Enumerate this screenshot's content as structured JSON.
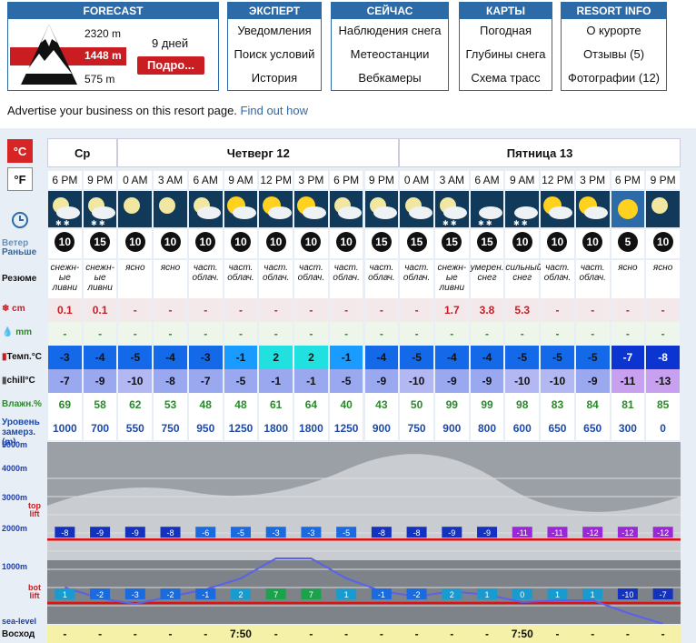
{
  "nav": {
    "forecast": {
      "title": "FORECAST",
      "elev_top": "2320 m",
      "elev_mid": "1448 m",
      "elev_bot": "575 m",
      "days": "9 дней",
      "detail": "Подро..."
    },
    "expert": {
      "title": "ЭКСПЕРТ",
      "items": [
        "Уведомления",
        "Поиск условий",
        "История"
      ]
    },
    "now": {
      "title": "СЕЙЧАС",
      "items": [
        "Наблюдения снега",
        "Метеостанции",
        "Вебкамеры"
      ]
    },
    "maps": {
      "title": "КАРТЫ",
      "items": [
        "Погодная",
        "Глубины снега",
        "Схема трасс"
      ]
    },
    "resort": {
      "title": "RESORT INFO",
      "items": [
        "О курорте",
        "Отзывы (5)",
        "Фотографии (12)"
      ]
    }
  },
  "advert": {
    "text": "Advertise your business on this resort page.",
    "link": "Find out how"
  },
  "units": {
    "c": "°C",
    "f": "°F"
  },
  "labels": {
    "earlier": "Раньше",
    "wind": "Ветер",
    "summary": "Резюме",
    "snow": "cm",
    "rain": "mm",
    "temp": "Темп.°C",
    "chill": "chill°C",
    "humidity": "Влажн.%",
    "freeze_level": "Уровень замерз. (m)",
    "sunrise": "Восход"
  },
  "days": [
    {
      "name": "Ср",
      "span": 2
    },
    {
      "name": "Четверг 12",
      "span": 8
    },
    {
      "name": "Пятница 13",
      "span": 8
    }
  ],
  "columns": [
    {
      "time": "6 PM",
      "wind": "10",
      "summary": "снежн-ые ливни",
      "snow": "0.1",
      "rain": "-",
      "temp": "-3",
      "chill": "-7",
      "hum": "69",
      "lvl": "1000",
      "sunrise": "-",
      "icon": "night-snow"
    },
    {
      "time": "9 PM",
      "wind": "15",
      "summary": "снежн-ые ливни",
      "snow": "0.1",
      "rain": "-",
      "temp": "-4",
      "chill": "-9",
      "hum": "58",
      "lvl": "700",
      "sunrise": "-",
      "icon": "night-snow"
    },
    {
      "time": "0 AM",
      "wind": "10",
      "summary": "ясно",
      "snow": "-",
      "rain": "-",
      "temp": "-5",
      "chill": "-10",
      "hum": "62",
      "lvl": "550",
      "sunrise": "-",
      "icon": "night-clear"
    },
    {
      "time": "3 AM",
      "wind": "10",
      "summary": "ясно",
      "snow": "-",
      "rain": "-",
      "temp": "-4",
      "chill": "-8",
      "hum": "53",
      "lvl": "750",
      "sunrise": "-",
      "icon": "night-clear"
    },
    {
      "time": "6 AM",
      "wind": "10",
      "summary": "част. облач.",
      "snow": "-",
      "rain": "-",
      "temp": "-3",
      "chill": "-7",
      "hum": "48",
      "lvl": "950",
      "sunrise": "-",
      "icon": "night-cloud"
    },
    {
      "time": "9 AM",
      "wind": "10",
      "summary": "част. облач.",
      "snow": "-",
      "rain": "-",
      "temp": "-1",
      "chill": "-5",
      "hum": "48",
      "lvl": "1250",
      "sunrise": "7:50",
      "icon": "day-cloud"
    },
    {
      "time": "12 PM",
      "wind": "10",
      "summary": "част. облач.",
      "snow": "-",
      "rain": "-",
      "temp": "2",
      "chill": "-1",
      "hum": "61",
      "lvl": "1800",
      "sunrise": "-",
      "icon": "day-cloud"
    },
    {
      "time": "3 PM",
      "wind": "10",
      "summary": "част. облач.",
      "snow": "-",
      "rain": "-",
      "temp": "2",
      "chill": "-1",
      "hum": "64",
      "lvl": "1800",
      "sunrise": "-",
      "icon": "day-cloud"
    },
    {
      "time": "6 PM",
      "wind": "10",
      "summary": "част. облач.",
      "snow": "-",
      "rain": "-",
      "temp": "-1",
      "chill": "-5",
      "hum": "40",
      "lvl": "1250",
      "sunrise": "-",
      "icon": "night-cloud"
    },
    {
      "time": "9 PM",
      "wind": "15",
      "summary": "част. облач.",
      "snow": "-",
      "rain": "-",
      "temp": "-4",
      "chill": "-9",
      "hum": "43",
      "lvl": "900",
      "sunrise": "-",
      "icon": "night-cloud"
    },
    {
      "time": "0 AM",
      "wind": "15",
      "summary": "част. облач.",
      "snow": "-",
      "rain": "-",
      "temp": "-5",
      "chill": "-10",
      "hum": "50",
      "lvl": "750",
      "sunrise": "-",
      "icon": "night-cloud"
    },
    {
      "time": "3 AM",
      "wind": "15",
      "summary": "снежн-ые ливни",
      "snow": "1.7",
      "rain": "-",
      "temp": "-4",
      "chill": "-9",
      "hum": "99",
      "lvl": "900",
      "sunrise": "-",
      "icon": "night-snow"
    },
    {
      "time": "6 AM",
      "wind": "15",
      "summary": "умерен. снег",
      "snow": "3.8",
      "rain": "-",
      "temp": "-4",
      "chill": "-9",
      "hum": "99",
      "lvl": "800",
      "sunrise": "-",
      "icon": "snow"
    },
    {
      "time": "9 AM",
      "wind": "10",
      "summary": "сильный снег",
      "snow": "5.3",
      "rain": "-",
      "temp": "-5",
      "chill": "-10",
      "hum": "98",
      "lvl": "600",
      "sunrise": "7:50",
      "icon": "snow"
    },
    {
      "time": "12 PM",
      "wind": "10",
      "summary": "част. облач.",
      "snow": "-",
      "rain": "-",
      "temp": "-5",
      "chill": "-10",
      "hum": "83",
      "lvl": "650",
      "sunrise": "-",
      "icon": "day-cloud"
    },
    {
      "time": "3 PM",
      "wind": "10",
      "summary": "част. облач.",
      "snow": "-",
      "rain": "-",
      "temp": "-5",
      "chill": "-9",
      "hum": "84",
      "lvl": "650",
      "sunrise": "-",
      "icon": "day-cloud"
    },
    {
      "time": "6 PM",
      "wind": "5",
      "summary": "ясно",
      "snow": "-",
      "rain": "-",
      "temp": "-7",
      "chill": "-11",
      "hum": "81",
      "lvl": "300",
      "sunrise": "-",
      "icon": "sunny"
    },
    {
      "time": "9 PM",
      "wind": "10",
      "summary": "ясно",
      "snow": "-",
      "rain": "-",
      "temp": "-8",
      "chill": "-13",
      "hum": "85",
      "lvl": "0",
      "sunrise": "-",
      "icon": "night-clear"
    }
  ],
  "chart": {
    "y_labels": [
      "5000m",
      "4000m",
      "3000m",
      "2000m",
      "1000m",
      "sea-level"
    ],
    "top_lift": "top lift",
    "bot_lift": "bot lift",
    "top_temps": [
      "-8",
      "-9",
      "-9",
      "-8",
      "-6",
      "-5",
      "-3",
      "-3",
      "-5",
      "-8",
      "-8",
      "-9",
      "-9",
      "-11",
      "-11",
      "-12",
      "-12",
      "-12"
    ],
    "bot_temps": [
      "1",
      "-2",
      "-3",
      "-2",
      "-1",
      "2",
      "7",
      "7",
      "1",
      "-1",
      "-2",
      "2",
      "1",
      "0",
      "1",
      "1",
      "-10",
      "-7"
    ]
  },
  "colors": {
    "brand": "#2d6aa8",
    "alert": "#c91d22"
  }
}
